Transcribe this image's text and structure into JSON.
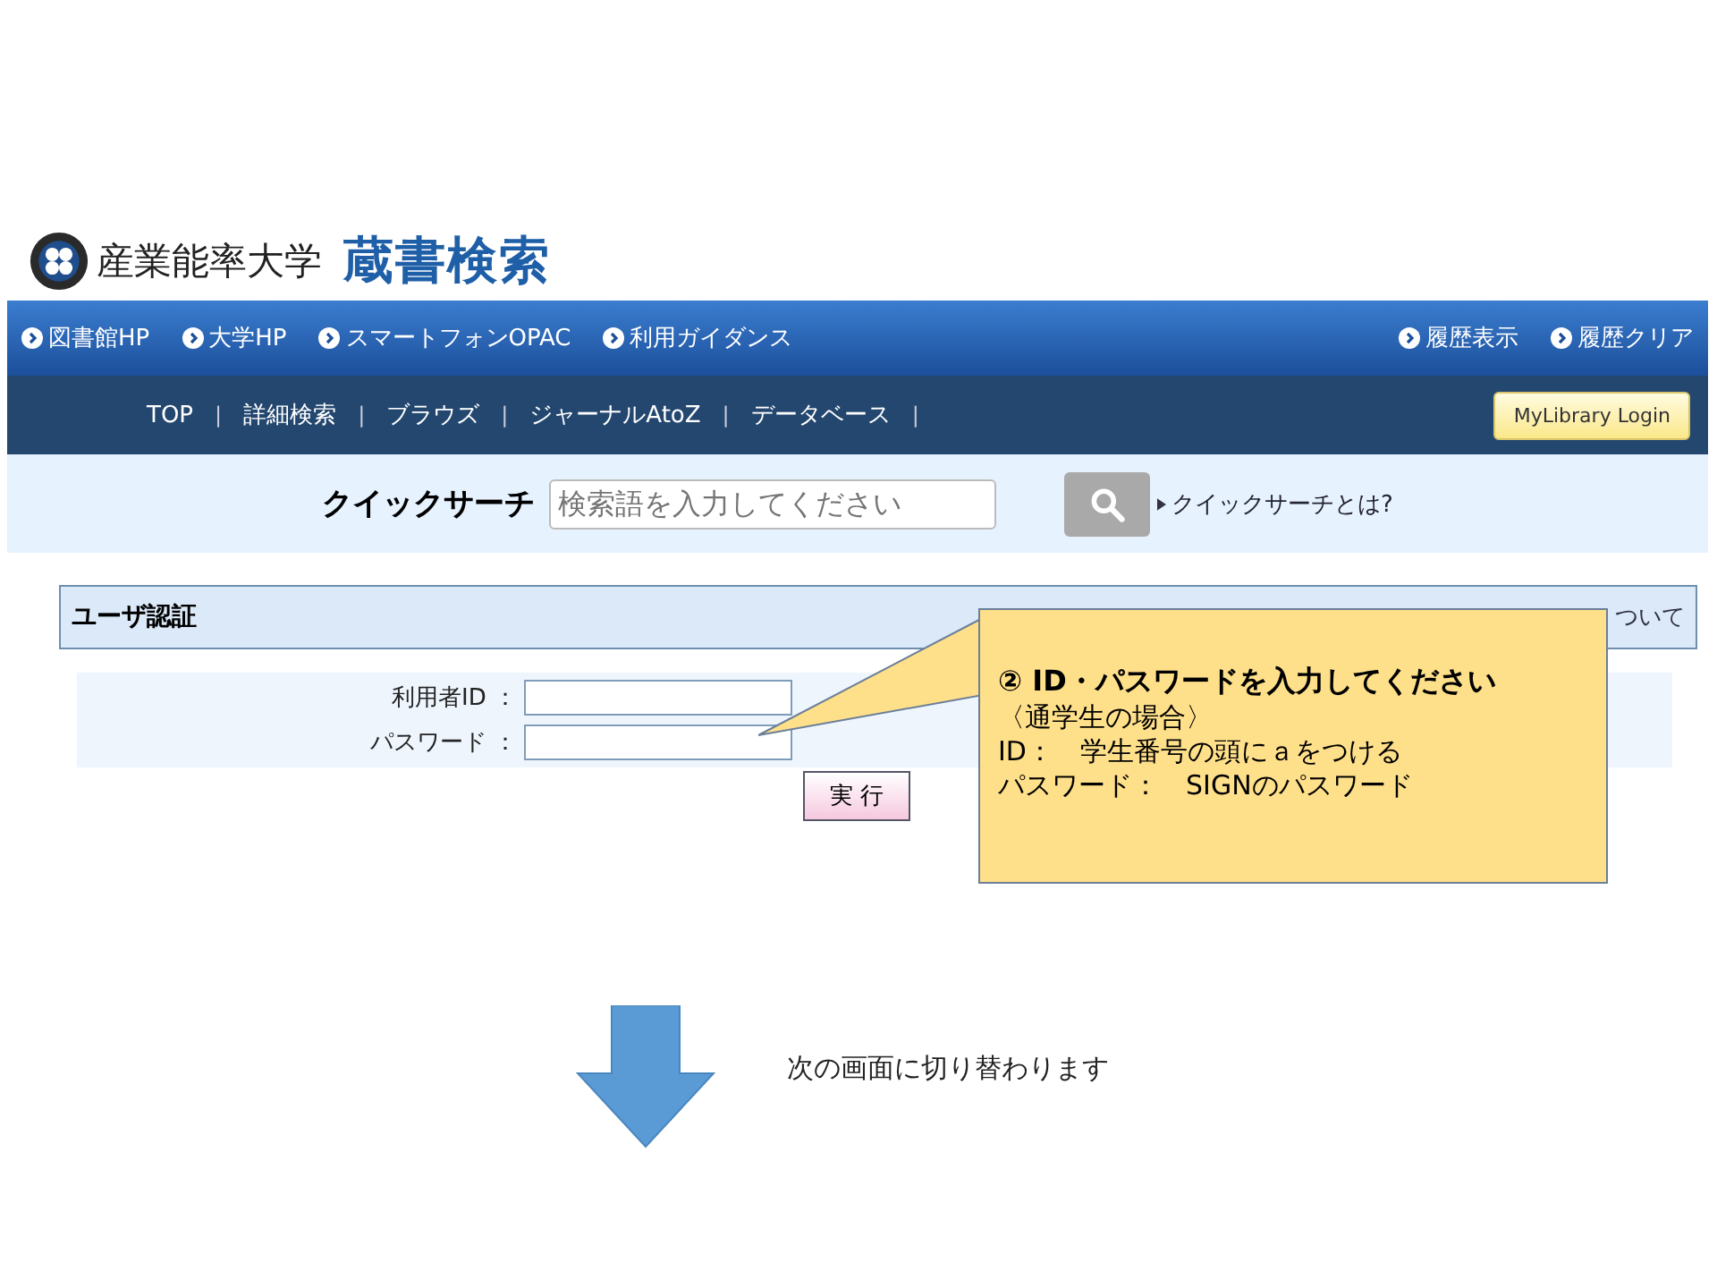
{
  "header": {
    "university": "産業能率大学",
    "title": "蔵書検索"
  },
  "top_links": [
    {
      "label": "図書館HP"
    },
    {
      "label": "大学HP"
    },
    {
      "label": "スマートフォンOPAC"
    },
    {
      "label": "利用ガイダンス"
    }
  ],
  "right_links": [
    {
      "label": "履歴表示"
    },
    {
      "label": "履歴クリア"
    }
  ],
  "nav": [
    {
      "kind": "link",
      "label": "TOP"
    },
    {
      "kind": "separator",
      "label": "|"
    },
    {
      "kind": "link",
      "label": "詳細検索"
    },
    {
      "kind": "separator",
      "label": "|"
    },
    {
      "kind": "link",
      "label": "ブラウズ"
    },
    {
      "kind": "separator",
      "label": "|"
    },
    {
      "kind": "link",
      "label": "ジャーナルAtoZ"
    },
    {
      "kind": "separator",
      "label": "|"
    },
    {
      "kind": "link",
      "label": "データベース"
    },
    {
      "kind": "separator",
      "label": "|"
    }
  ],
  "login_button": "MyLibrary Login",
  "quick_search": {
    "label": "クイックサーチ",
    "placeholder": "検索語を入力してください",
    "help_link": "クイックサーチとは?"
  },
  "auth": {
    "title": "ユーザ認証",
    "side_link": "ついて",
    "fields": [
      {
        "label": "利用者ID ："
      },
      {
        "label": "パスワード ："
      }
    ],
    "submit": "実 行"
  },
  "callout": {
    "heading": "② ID・パスワードを入力してください",
    "lines": [
      "〈通学生の場合〉",
      "ID：　学生番号の頭にａをつける",
      "パスワード：　SIGNのパスワード"
    ]
  },
  "next_note": "次の画面に切り替わります"
}
